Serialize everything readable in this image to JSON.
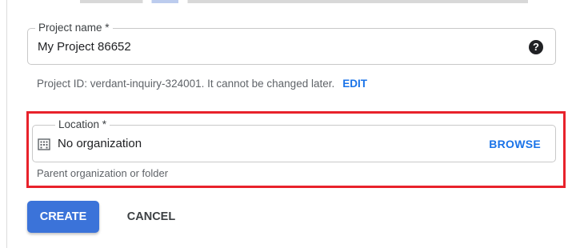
{
  "project_field": {
    "label": "Project name *",
    "value": "My Project 86652",
    "help_icon": "help-circle-icon"
  },
  "project_id": {
    "text": "Project ID: verdant-inquiry-324001. It cannot be changed later.",
    "edit_label": "EDIT"
  },
  "location_field": {
    "label": "Location *",
    "value": "No organization",
    "icon": "building-icon",
    "browse_label": "BROWSE",
    "hint": "Parent organization or folder"
  },
  "actions": {
    "create_label": "CREATE",
    "cancel_label": "CANCEL"
  },
  "colors": {
    "accent": "#1a73e8",
    "primary_button": "#3b73d9",
    "highlight": "#e8222b"
  }
}
